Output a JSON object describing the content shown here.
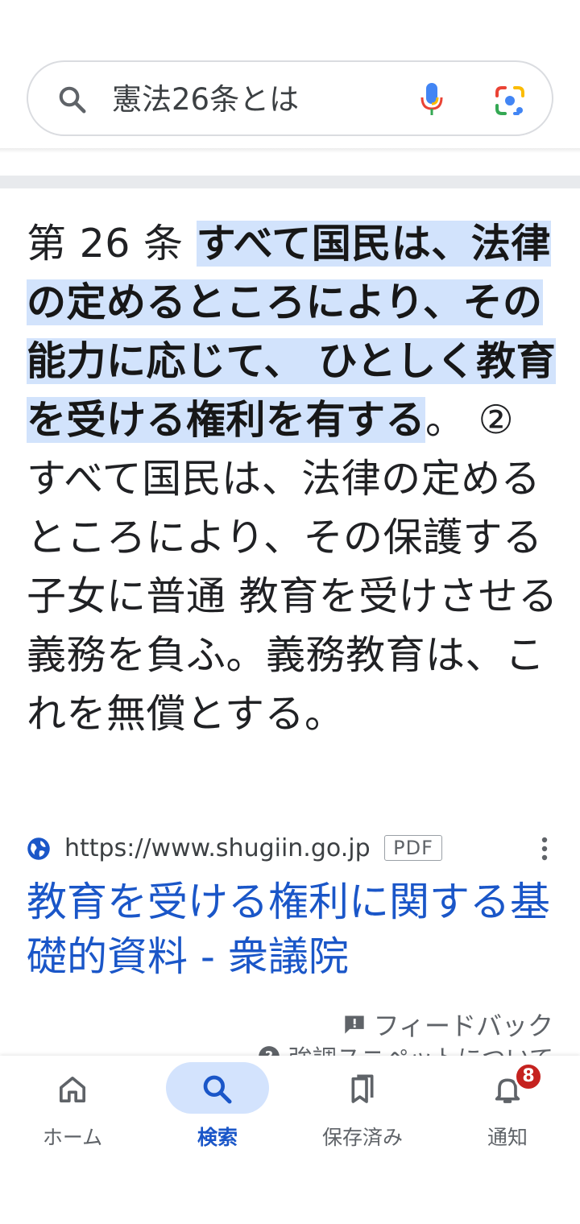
{
  "search": {
    "query": "憲法26条とは",
    "search_icon": "search-icon",
    "mic_icon": "microphone-icon",
    "lens_icon": "camera-lens-icon"
  },
  "snippet": {
    "prefix": "第 26 条 ",
    "highlighted": "すべて国民は、法律の定めるところにより、その能力に応じて、 ひとしく教育を受ける権利を有する",
    "rest": "。 ② すべて国民は、法律の定めるところにより、その保護する子女に普通 教育を受けさせる義務を負ふ。義務教育は、これを無償とする。"
  },
  "result": {
    "url": "https://www.shugiin.go.jp",
    "badge": "PDF",
    "title": "教育を受ける権利に関する基礎的資料 - 衆議院",
    "more_icon": "more-vert-icon"
  },
  "footer": {
    "feedback": "フィードバック",
    "about": "強調スニペットについて"
  },
  "nav": {
    "items": [
      {
        "label": "ホーム",
        "icon": "home-icon"
      },
      {
        "label": "検索",
        "icon": "search-icon",
        "active": true
      },
      {
        "label": "保存済み",
        "icon": "bookmark-icon"
      },
      {
        "label": "通知",
        "icon": "bell-icon",
        "badge": "8"
      }
    ]
  },
  "colors": {
    "highlight": "#d2e3fc",
    "link": "#1a56c8",
    "active_pill": "#d3e3fd",
    "badge": "#c5221f"
  }
}
